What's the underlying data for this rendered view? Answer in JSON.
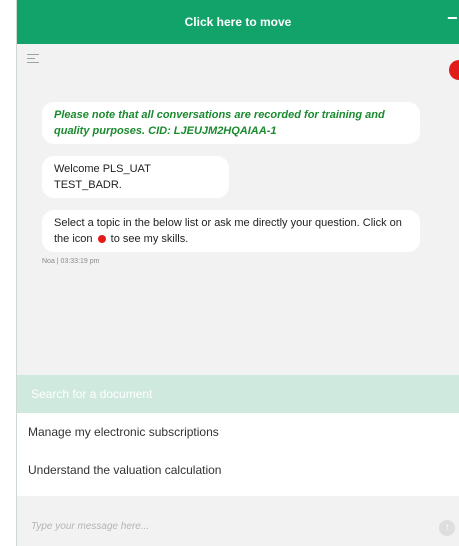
{
  "header": {
    "title": "Click here to move",
    "minimize_icon": "minus-icon"
  },
  "toolbar": {
    "menu_icon": "hamburger-icon",
    "status_icon": "red-dot-icon"
  },
  "messages": [
    {
      "text": "Please note that all conversations are recorded for training and quality purposes. CID: LJEUJM2HQAIAA-1",
      "type": "notice"
    },
    {
      "text": "Welcome PLS_UAT TEST_BADR.",
      "type": "bot"
    },
    {
      "text_before": "Select a topic in the below list or ask me directly your question. Click on the icon",
      "text_after": "to see my skills.",
      "type": "bot"
    }
  ],
  "message_meta": "Noa | 03:33:19 pm",
  "search": {
    "placeholder": "Search for a document"
  },
  "suggestions": [
    "Manage my electronic subscriptions",
    "Understand the valuation calculation"
  ],
  "input": {
    "placeholder": "Type your message here...",
    "send_icon": "send-arrow-icon"
  },
  "colors": {
    "brand": "#12a36b",
    "notice": "#1a8a2e",
    "dot": "#e31b1b",
    "search_bg": "#cfe9df"
  }
}
